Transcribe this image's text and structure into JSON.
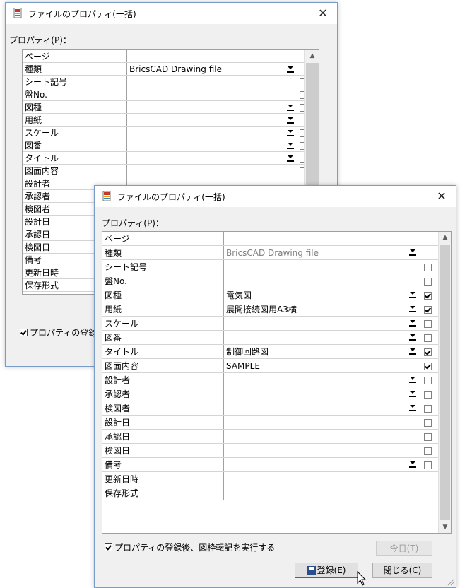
{
  "back": {
    "title": "ファイルのプロパティ(一括)",
    "close": "✕",
    "props_label": "プロパティ(P)：",
    "rows": [
      {
        "name": "ページ",
        "value": "",
        "dropdown": false,
        "check": null
      },
      {
        "name": "種類",
        "value": "BricsCAD Drawing file",
        "dropdown": true,
        "check": null
      },
      {
        "name": "シート記号",
        "value": "",
        "dropdown": false,
        "check": false
      },
      {
        "name": "盤No.",
        "value": "",
        "dropdown": false,
        "check": false
      },
      {
        "name": "図種",
        "value": "",
        "dropdown": true,
        "check": false
      },
      {
        "name": "用紙",
        "value": "",
        "dropdown": true,
        "check": false
      },
      {
        "name": "スケール",
        "value": "",
        "dropdown": true,
        "check": false
      },
      {
        "name": "図番",
        "value": "",
        "dropdown": true,
        "check": false
      },
      {
        "name": "タイトル",
        "value": "",
        "dropdown": true,
        "check": false
      },
      {
        "name": "図面内容",
        "value": "",
        "dropdown": false,
        "check": false
      },
      {
        "name": "設計者",
        "value": "",
        "dropdown": false,
        "check": null
      },
      {
        "name": "承認者",
        "value": "",
        "dropdown": false,
        "check": null
      },
      {
        "name": "検図者",
        "value": "",
        "dropdown": false,
        "check": null
      },
      {
        "name": "設計日",
        "value": "",
        "dropdown": false,
        "check": null
      },
      {
        "name": "承認日",
        "value": "",
        "dropdown": false,
        "check": null
      },
      {
        "name": "検図日",
        "value": "",
        "dropdown": false,
        "check": null
      },
      {
        "name": "備考",
        "value": "",
        "dropdown": false,
        "check": null
      },
      {
        "name": "更新日時",
        "value": "",
        "dropdown": false,
        "check": null
      },
      {
        "name": "保存形式",
        "value": "",
        "dropdown": false,
        "check": null
      }
    ],
    "footer_check": "プロパティの登録"
  },
  "front": {
    "title": "ファイルのプロパティ(一括)",
    "close": "✕",
    "props_label": "プロパティ(P)：",
    "rows": [
      {
        "name": "ページ",
        "value": "",
        "dropdown": false,
        "check": null,
        "gray": false
      },
      {
        "name": "種類",
        "value": "BricsCAD Drawing file",
        "dropdown": true,
        "check": null,
        "gray": true
      },
      {
        "name": "シート記号",
        "value": "",
        "dropdown": false,
        "check": false,
        "gray": false
      },
      {
        "name": "盤No.",
        "value": "",
        "dropdown": false,
        "check": false,
        "gray": false
      },
      {
        "name": "図種",
        "value": "電気図",
        "dropdown": true,
        "check": true,
        "gray": false
      },
      {
        "name": "用紙",
        "value": "展開接続図用A3横",
        "dropdown": true,
        "check": true,
        "gray": false
      },
      {
        "name": "スケール",
        "value": "",
        "dropdown": true,
        "check": false,
        "gray": false
      },
      {
        "name": "図番",
        "value": "",
        "dropdown": true,
        "check": false,
        "gray": false
      },
      {
        "name": "タイトル",
        "value": "制御回路図",
        "dropdown": true,
        "check": true,
        "gray": false
      },
      {
        "name": "図面内容",
        "value": "SAMPLE",
        "dropdown": false,
        "check": true,
        "gray": false
      },
      {
        "name": "設計者",
        "value": "",
        "dropdown": true,
        "check": false,
        "gray": false
      },
      {
        "name": "承認者",
        "value": "",
        "dropdown": true,
        "check": false,
        "gray": false
      },
      {
        "name": "検図者",
        "value": "",
        "dropdown": true,
        "check": false,
        "gray": false
      },
      {
        "name": "設計日",
        "value": "",
        "dropdown": false,
        "check": false,
        "gray": false
      },
      {
        "name": "承認日",
        "value": "",
        "dropdown": false,
        "check": false,
        "gray": false
      },
      {
        "name": "検図日",
        "value": "",
        "dropdown": false,
        "check": false,
        "gray": false
      },
      {
        "name": "備考",
        "value": "",
        "dropdown": true,
        "check": false,
        "gray": false
      },
      {
        "name": "更新日時",
        "value": "",
        "dropdown": false,
        "check": null,
        "gray": false
      },
      {
        "name": "保存形式",
        "value": "",
        "dropdown": false,
        "check": null,
        "gray": false
      }
    ],
    "footer_check": "プロパティの登録後、図枠転記を実行する",
    "today_button": "今日(T)",
    "register_button": "登録(E)",
    "close_button": "閉じる(C)"
  },
  "icons": {
    "app": "bricscad-file-icon",
    "close": "close-icon",
    "dropdown": "chevron-down-icon",
    "save": "floppy-disk-icon",
    "cursor": "mouse-pointer-icon"
  }
}
